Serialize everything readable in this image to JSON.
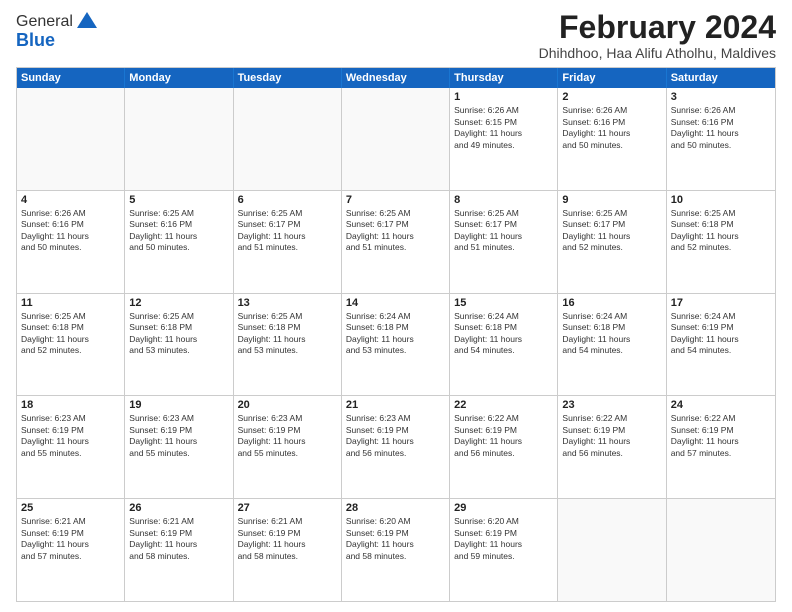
{
  "header": {
    "logo": {
      "general": "General",
      "blue": "Blue"
    },
    "title": "February 2024",
    "subtitle": "Dhihdhoo, Haa Alifu Atholhu, Maldives"
  },
  "days_of_week": [
    "Sunday",
    "Monday",
    "Tuesday",
    "Wednesday",
    "Thursday",
    "Friday",
    "Saturday"
  ],
  "weeks": [
    [
      {
        "day": "",
        "info": ""
      },
      {
        "day": "",
        "info": ""
      },
      {
        "day": "",
        "info": ""
      },
      {
        "day": "",
        "info": ""
      },
      {
        "day": "1",
        "info": "Sunrise: 6:26 AM\nSunset: 6:15 PM\nDaylight: 11 hours\nand 49 minutes."
      },
      {
        "day": "2",
        "info": "Sunrise: 6:26 AM\nSunset: 6:16 PM\nDaylight: 11 hours\nand 50 minutes."
      },
      {
        "day": "3",
        "info": "Sunrise: 6:26 AM\nSunset: 6:16 PM\nDaylight: 11 hours\nand 50 minutes."
      }
    ],
    [
      {
        "day": "4",
        "info": "Sunrise: 6:26 AM\nSunset: 6:16 PM\nDaylight: 11 hours\nand 50 minutes."
      },
      {
        "day": "5",
        "info": "Sunrise: 6:25 AM\nSunset: 6:16 PM\nDaylight: 11 hours\nand 50 minutes."
      },
      {
        "day": "6",
        "info": "Sunrise: 6:25 AM\nSunset: 6:17 PM\nDaylight: 11 hours\nand 51 minutes."
      },
      {
        "day": "7",
        "info": "Sunrise: 6:25 AM\nSunset: 6:17 PM\nDaylight: 11 hours\nand 51 minutes."
      },
      {
        "day": "8",
        "info": "Sunrise: 6:25 AM\nSunset: 6:17 PM\nDaylight: 11 hours\nand 51 minutes."
      },
      {
        "day": "9",
        "info": "Sunrise: 6:25 AM\nSunset: 6:17 PM\nDaylight: 11 hours\nand 52 minutes."
      },
      {
        "day": "10",
        "info": "Sunrise: 6:25 AM\nSunset: 6:18 PM\nDaylight: 11 hours\nand 52 minutes."
      }
    ],
    [
      {
        "day": "11",
        "info": "Sunrise: 6:25 AM\nSunset: 6:18 PM\nDaylight: 11 hours\nand 52 minutes."
      },
      {
        "day": "12",
        "info": "Sunrise: 6:25 AM\nSunset: 6:18 PM\nDaylight: 11 hours\nand 53 minutes."
      },
      {
        "day": "13",
        "info": "Sunrise: 6:25 AM\nSunset: 6:18 PM\nDaylight: 11 hours\nand 53 minutes."
      },
      {
        "day": "14",
        "info": "Sunrise: 6:24 AM\nSunset: 6:18 PM\nDaylight: 11 hours\nand 53 minutes."
      },
      {
        "day": "15",
        "info": "Sunrise: 6:24 AM\nSunset: 6:18 PM\nDaylight: 11 hours\nand 54 minutes."
      },
      {
        "day": "16",
        "info": "Sunrise: 6:24 AM\nSunset: 6:18 PM\nDaylight: 11 hours\nand 54 minutes."
      },
      {
        "day": "17",
        "info": "Sunrise: 6:24 AM\nSunset: 6:19 PM\nDaylight: 11 hours\nand 54 minutes."
      }
    ],
    [
      {
        "day": "18",
        "info": "Sunrise: 6:23 AM\nSunset: 6:19 PM\nDaylight: 11 hours\nand 55 minutes."
      },
      {
        "day": "19",
        "info": "Sunrise: 6:23 AM\nSunset: 6:19 PM\nDaylight: 11 hours\nand 55 minutes."
      },
      {
        "day": "20",
        "info": "Sunrise: 6:23 AM\nSunset: 6:19 PM\nDaylight: 11 hours\nand 55 minutes."
      },
      {
        "day": "21",
        "info": "Sunrise: 6:23 AM\nSunset: 6:19 PM\nDaylight: 11 hours\nand 56 minutes."
      },
      {
        "day": "22",
        "info": "Sunrise: 6:22 AM\nSunset: 6:19 PM\nDaylight: 11 hours\nand 56 minutes."
      },
      {
        "day": "23",
        "info": "Sunrise: 6:22 AM\nSunset: 6:19 PM\nDaylight: 11 hours\nand 56 minutes."
      },
      {
        "day": "24",
        "info": "Sunrise: 6:22 AM\nSunset: 6:19 PM\nDaylight: 11 hours\nand 57 minutes."
      }
    ],
    [
      {
        "day": "25",
        "info": "Sunrise: 6:21 AM\nSunset: 6:19 PM\nDaylight: 11 hours\nand 57 minutes."
      },
      {
        "day": "26",
        "info": "Sunrise: 6:21 AM\nSunset: 6:19 PM\nDaylight: 11 hours\nand 58 minutes."
      },
      {
        "day": "27",
        "info": "Sunrise: 6:21 AM\nSunset: 6:19 PM\nDaylight: 11 hours\nand 58 minutes."
      },
      {
        "day": "28",
        "info": "Sunrise: 6:20 AM\nSunset: 6:19 PM\nDaylight: 11 hours\nand 58 minutes."
      },
      {
        "day": "29",
        "info": "Sunrise: 6:20 AM\nSunset: 6:19 PM\nDaylight: 11 hours\nand 59 minutes."
      },
      {
        "day": "",
        "info": ""
      },
      {
        "day": "",
        "info": ""
      }
    ]
  ]
}
